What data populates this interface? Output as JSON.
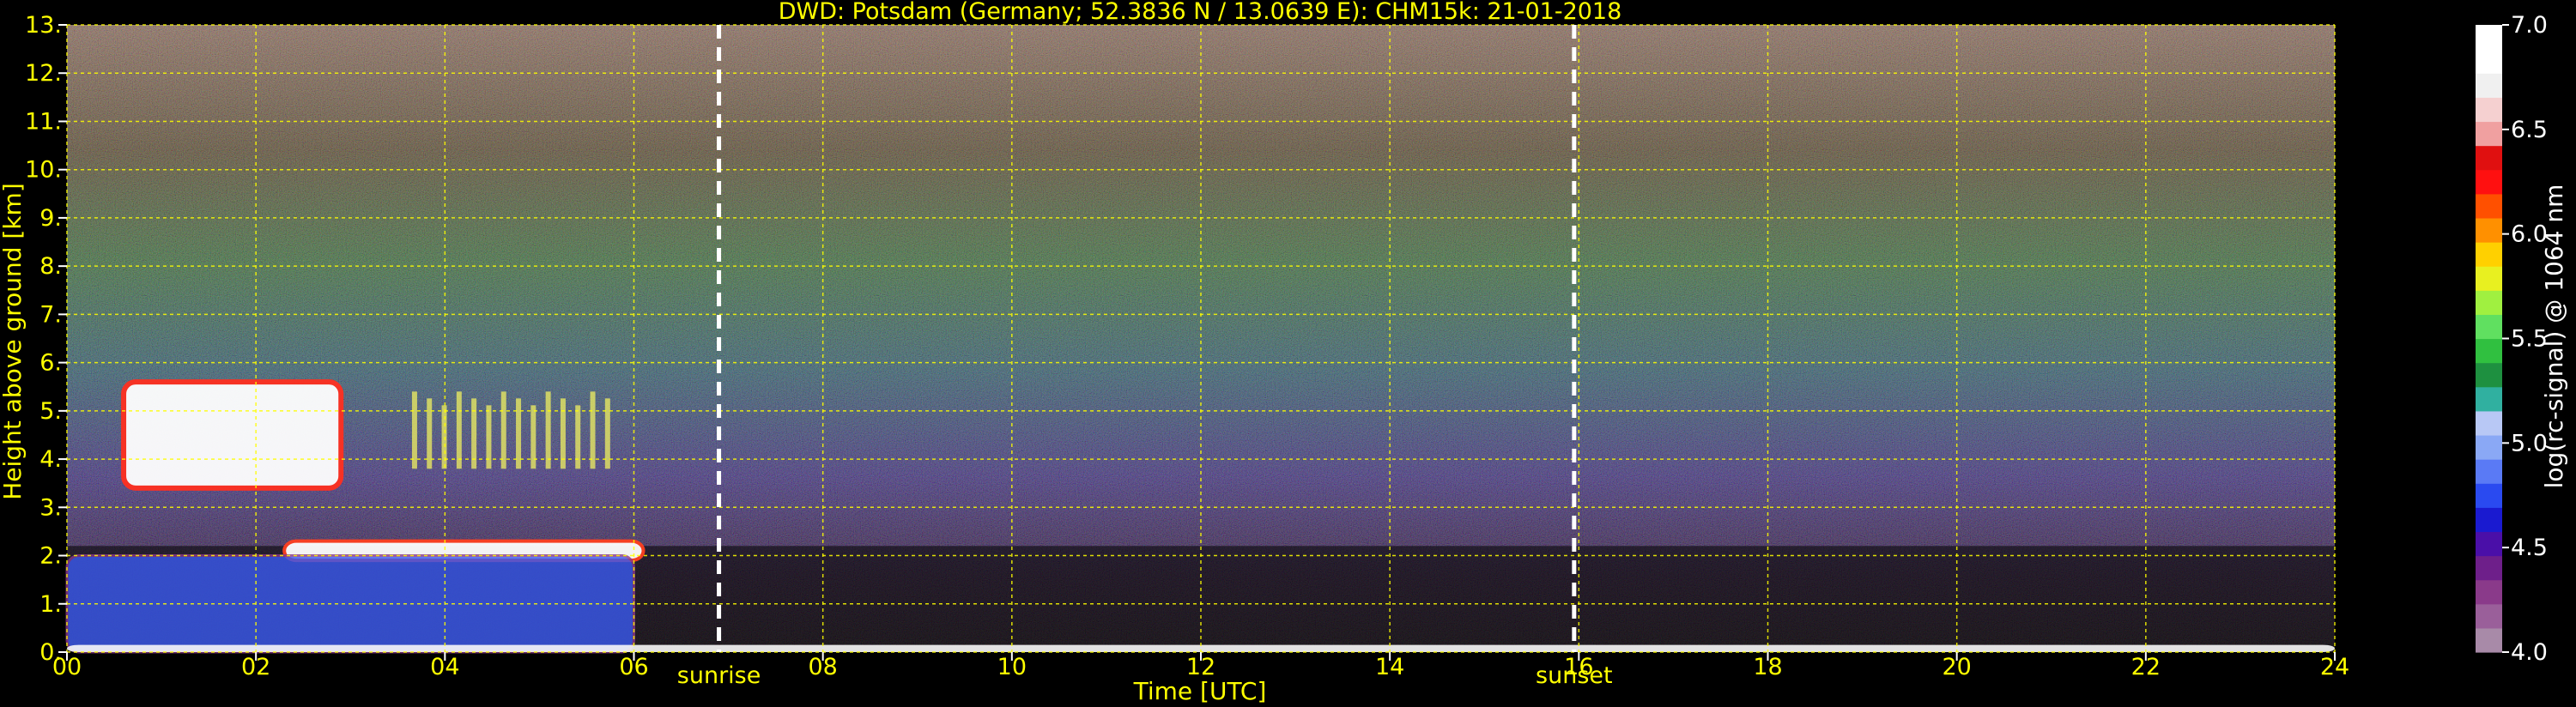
{
  "chart_data": {
    "type": "heatmap",
    "title": "DWD: Potsdam (Germany; 52.3836 N / 13.0639 E):    CHM15k: 21-01-2018",
    "xlabel": "Time [UTC]",
    "ylabel": "Height above ground [km]",
    "colorbar_label": "log(rc-signal) @ 1064 nm",
    "xlim": [
      0,
      24
    ],
    "ylim": [
      0,
      13
    ],
    "clim": [
      4.0,
      7.0
    ],
    "x_ticks": [
      0,
      2,
      4,
      6,
      8,
      10,
      12,
      14,
      16,
      18,
      20,
      22,
      24
    ],
    "x_tick_labels": [
      "00",
      "02",
      "04",
      "06",
      "08",
      "10",
      "12",
      "14",
      "16",
      "18",
      "20",
      "22",
      "24"
    ],
    "y_ticks": [
      0,
      1,
      2,
      3,
      4,
      5,
      6,
      7,
      8,
      9,
      10,
      11,
      12,
      13
    ],
    "y_tick_labels": [
      "0.",
      "1.",
      "2.",
      "3.",
      "4.",
      "5.",
      "6.",
      "7.",
      "8.",
      "9.",
      "10.",
      "11.",
      "12.",
      "13."
    ],
    "colorbar_ticks": [
      4.0,
      4.5,
      5.0,
      5.5,
      6.0,
      6.5,
      7.0
    ],
    "colorbar_tick_labels": [
      "4.0",
      "4.5",
      "5.0",
      "5.5",
      "6.0",
      "6.5",
      "7.0"
    ],
    "colorbar_colors": [
      "#a88aa8",
      "#9a5f9a",
      "#8a3a8a",
      "#6e1f8a",
      "#4a0fa8",
      "#1a1ad0",
      "#2a4af0",
      "#5a7af5",
      "#8aa8f5",
      "#b8c8f5",
      "#30b0a0",
      "#1e9040",
      "#30c040",
      "#60e060",
      "#a0f040",
      "#e8f020",
      "#ffd000",
      "#ff9000",
      "#ff5000",
      "#ff1010",
      "#e01010",
      "#f0a0a0",
      "#f5d0d0",
      "#f0f0f0",
      "#ffffff",
      "#ffffff"
    ],
    "grid": true,
    "grid_color": "#ffff00",
    "text_color": "#ffff00",
    "annotations": [
      {
        "label": "sunrise",
        "x": 6.9
      },
      {
        "label": "sunset",
        "x": 15.95
      }
    ],
    "features": [
      {
        "name": "cirrus",
        "x_range": [
          0.6,
          2.9
        ],
        "y_range": [
          3.4,
          5.6
        ]
      },
      {
        "name": "virga streaks",
        "x_range": [
          3.6,
          5.8
        ],
        "y_range": [
          3.8,
          5.4
        ]
      },
      {
        "name": "cloud deck",
        "x_range": [
          2.3,
          6.1
        ],
        "y_range": [
          1.9,
          2.3
        ]
      },
      {
        "name": "boundary layer",
        "x_range": [
          0,
          6.0
        ],
        "y_range": [
          0,
          2.0
        ]
      },
      {
        "name": "surface layer",
        "x_range": [
          0,
          24
        ],
        "y_range": [
          0,
          0.15
        ]
      }
    ]
  }
}
